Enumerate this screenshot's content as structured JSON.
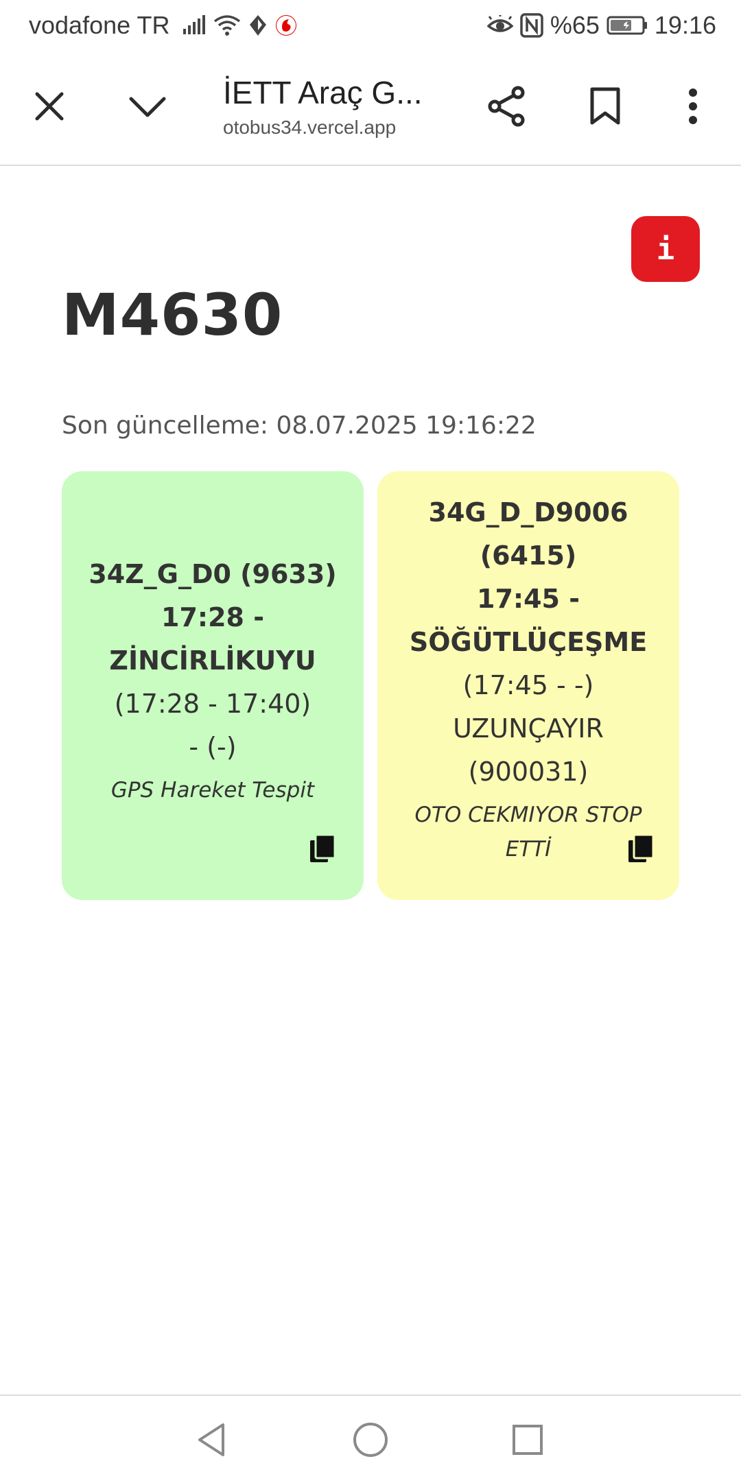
{
  "status_bar": {
    "carrier": "vodafone TR",
    "battery": "%65",
    "time": "19:16",
    "icons": [
      "signal-icon",
      "wifi-icon",
      "data-saver-icon",
      "vodafone-icon",
      "eye-comfort-icon",
      "nfc-icon",
      "battery-icon"
    ]
  },
  "browser": {
    "title": "İETT Araç G...",
    "url": "otobus34.vercel.app",
    "icons": [
      "close-icon",
      "chevron-down-icon",
      "share-icon",
      "bookmark-icon",
      "more-vert-icon"
    ]
  },
  "page": {
    "info_label": "i",
    "title": "M4630",
    "updated": "Son güncelleme: 08.07.2025 19:16:22"
  },
  "cards": [
    {
      "color": "#c8fcc0",
      "bold_lines": [
        "34Z_G_D0 (9633)",
        "17:28 -",
        "ZİNCİRLİKUYU"
      ],
      "lines": [
        "(17:28 - 17:40)",
        "- (-)"
      ],
      "note": "GPS Hareket Tespit"
    },
    {
      "color": "#fcfcb4",
      "bold_lines": [
        "34G_D_D9006",
        "(6415)",
        "17:45 -",
        "SÖĞÜTLÜÇEŞME"
      ],
      "lines": [
        "(17:45 - -)",
        "UZUNÇAYIR",
        "(900031)"
      ],
      "note": "OTO CEKMIYOR STOP ETTİ"
    }
  ],
  "colors": {
    "info_button": "#e21b22",
    "card_green": "#c8fcc0",
    "card_yellow": "#fcfcb4"
  },
  "nav_bar": {
    "icons": [
      "back-icon",
      "home-icon",
      "recents-icon"
    ]
  }
}
